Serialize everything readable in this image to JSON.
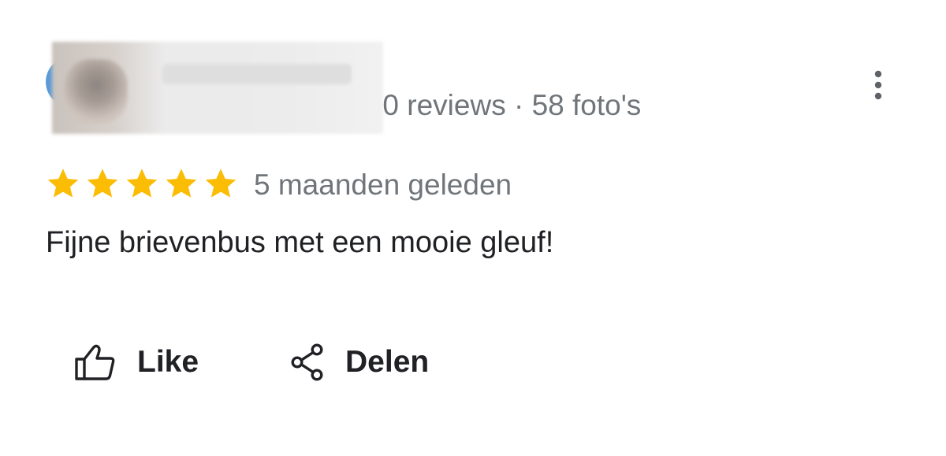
{
  "reviewer": {
    "name": "",
    "meta_clipped_prefix": "0",
    "meta_text": " reviews · 58 foto's",
    "rating": 5
  },
  "review": {
    "stars": [
      "star",
      "star",
      "star",
      "star",
      "star"
    ],
    "time_ago": "5 maanden geleden",
    "text": "Fijne brievenbus met een mooie gleuf!"
  },
  "actions": {
    "like_label": "Like",
    "share_label": "Delen"
  },
  "icons": {
    "more": "more-vert-icon",
    "like": "thumb-up-icon",
    "share": "share-icon",
    "star": "star-icon"
  },
  "colors": {
    "star": "#fbbc04",
    "secondary_text": "#70757a",
    "primary_text": "#202124",
    "avatar_ring": "#5b9bd5"
  }
}
